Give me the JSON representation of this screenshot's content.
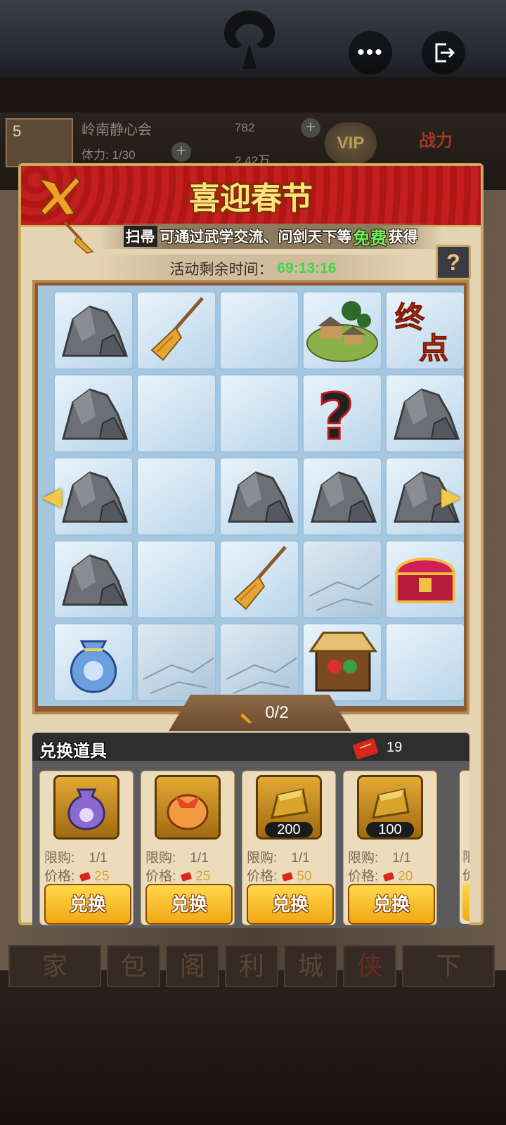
{
  "top_bar": {
    "more_label": "•••"
  },
  "player": {
    "level": "5",
    "name": "岭南静心会",
    "stamina": "体力: 1/30",
    "silver": "782",
    "gold": "2.42万",
    "vip_label": "VIP",
    "power_label": "战力"
  },
  "bottom_tabs": [
    "家",
    "包",
    "阁",
    "利",
    "城",
    "侠",
    "下"
  ],
  "dialog": {
    "title": "喜迎春节",
    "banner": {
      "broom": "扫帚",
      "text_before": "可通过武学交流、问剑天下等",
      "free": "免费",
      "text_after": "获得"
    },
    "timer_label": "活动剩余时间：",
    "timer_value": "69:13:16",
    "help_label": "?",
    "board": {
      "rows": [
        [
          "rock",
          "broom",
          "ice",
          "village",
          "end"
        ],
        [
          "rock",
          "ice",
          "ice",
          "mystery",
          "rock"
        ],
        [
          "rock",
          "ice",
          "rock",
          "rock",
          "rock"
        ],
        [
          "rock",
          "ice",
          "broom",
          "frozen",
          "treasure-chest"
        ],
        [
          "lucky-bag",
          "frozen",
          "frozen",
          "gift-stall",
          "ice"
        ]
      ],
      "end_label": "终点",
      "broom_count": "0/2"
    },
    "exchange": {
      "title": "兑换道具",
      "ticket_count": "19",
      "limit_label": "限购:",
      "price_label": "价格:",
      "button_label": "兑换",
      "items": [
        {
          "icon": "purple-bag-icon",
          "qty": "",
          "limit": "1/1",
          "price": "25"
        },
        {
          "icon": "orange-bundle-icon",
          "qty": "",
          "limit": "1/1",
          "price": "25"
        },
        {
          "icon": "gold-ingot-icon",
          "qty": "200",
          "limit": "1/1",
          "price": "50"
        },
        {
          "icon": "gold-ingot-icon",
          "qty": "100",
          "limit": "1/1",
          "price": "20"
        }
      ],
      "peek_limit": "限",
      "peek_price": "价"
    }
  }
}
